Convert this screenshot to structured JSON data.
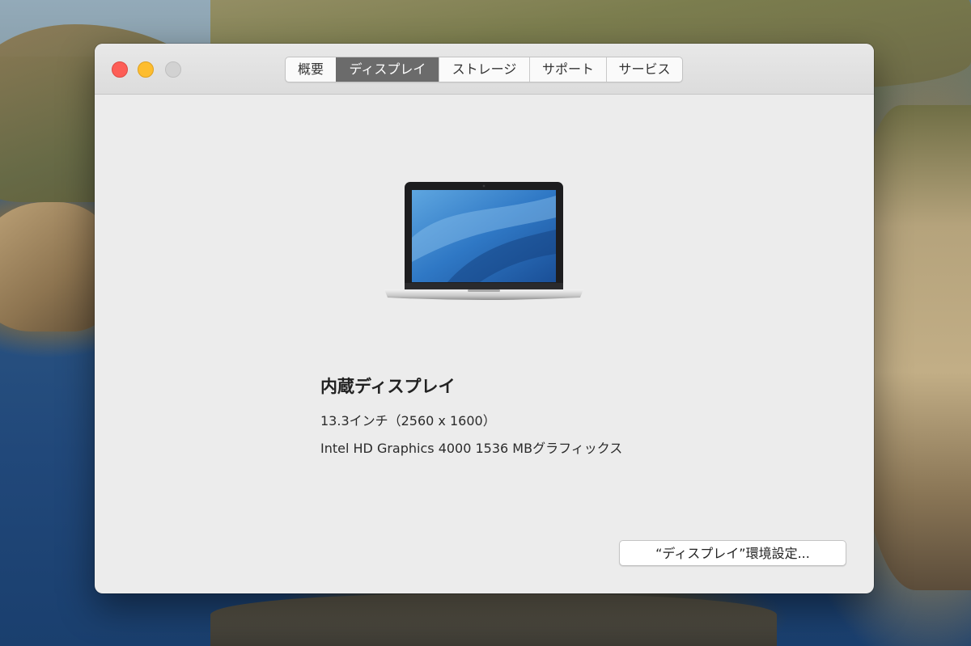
{
  "window": {
    "tabs": [
      {
        "label": "概要",
        "active": false
      },
      {
        "label": "ディスプレイ",
        "active": true
      },
      {
        "label": "ストレージ",
        "active": false
      },
      {
        "label": "サポート",
        "active": false
      },
      {
        "label": "サービス",
        "active": false
      }
    ]
  },
  "display": {
    "icon": "macbook-pro-laptop-icon",
    "name": "内蔵ディスプレイ",
    "size": "13.3インチ（2560 x 1600）",
    "graphics": "Intel HD Graphics 4000 1536 MBグラフィックス"
  },
  "footer": {
    "preferences_button": "“ディスプレイ”環境設定..."
  },
  "colors": {
    "close": "#fd5e57",
    "minimize": "#fdbd2f",
    "zoom_disabled": "#d2d2d2",
    "active_tab": "#6b6b6b",
    "window_bg": "#ececec"
  }
}
